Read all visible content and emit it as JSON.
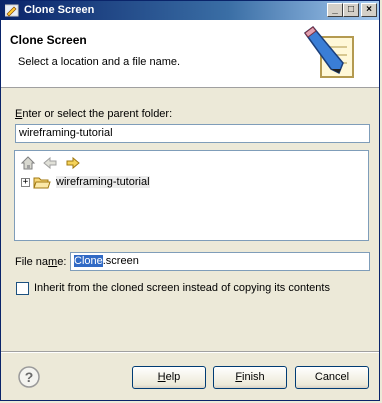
{
  "window": {
    "title": "Clone Screen",
    "controls": {
      "minimize": "_",
      "maximize": "□",
      "close": "×"
    }
  },
  "header": {
    "title": "Clone Screen",
    "description": "Select a location and a file name."
  },
  "parent_folder": {
    "label_accel": "E",
    "label_rest": "nter or select the parent folder:",
    "value": "wireframing-tutorial"
  },
  "tree": {
    "toolbar_icons": [
      "home-icon",
      "back-arrow-icon",
      "forward-arrow-icon"
    ],
    "expander": "+",
    "item_label": "wireframing-tutorial"
  },
  "file_name": {
    "label_before": "File na",
    "label_accel": "m",
    "label_after": "e:",
    "value_selected": "Clone",
    "value_rest": ".screen"
  },
  "inherit_checkbox": {
    "label": "Inherit from the cloned screen instead of copying its contents",
    "checked": false
  },
  "buttons": {
    "help": {
      "accel": "H",
      "rest": "elp"
    },
    "finish": {
      "accel": "F",
      "rest": "inish"
    },
    "cancel": "Cancel"
  },
  "help_icon_glyph": "?"
}
